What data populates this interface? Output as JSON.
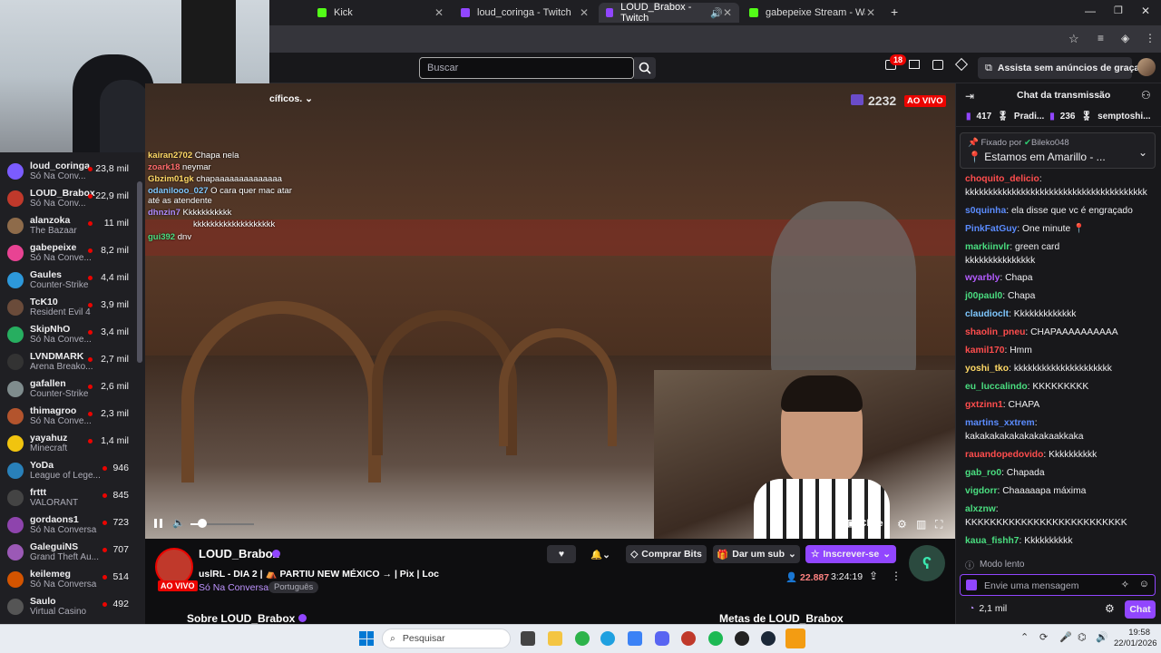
{
  "browser": {
    "tabs": [
      {
        "title": "Kick",
        "color": "#53fc18"
      },
      {
        "title": "loud_coringa - Twitch",
        "color": "#9146ff"
      },
      {
        "title": "LOUD_Brabox - Twitch",
        "color": "#9146ff"
      },
      {
        "title": "gabepeixe Stream - Watch Live",
        "color": "#53fc18"
      }
    ],
    "new_tab": "+"
  },
  "topnav": {
    "search_placeholder": "Buscar",
    "notif_count": "18",
    "ad_free": "Assista sem anúncios de graça"
  },
  "video": {
    "category_text": "cíficos.",
    "viewers": "2232",
    "live_badge": "AO VIVO",
    "clip_label": "Clipe",
    "overlay_chat": [
      {
        "user": "kairan2702",
        "text": "Chapa nela",
        "color": "#ffd966"
      },
      {
        "user": "zoark18",
        "text": "neymar",
        "color": "#ff6b6b"
      },
      {
        "user": "Gbzim01gk",
        "text": "chapaaaaaaaaaaaaaa",
        "color": "#ffd966"
      },
      {
        "user": "odanilooo_027",
        "text": "O cara quer mac atar",
        "color": "#7fc8ff"
      },
      {
        "user": "",
        "text": "até as atendente",
        "color": "#ffffff"
      },
      {
        "user": "dhnzin7",
        "text": "Kkkkkkkkkkk",
        "color": "#b08cff"
      },
      {
        "user": "",
        "text": "kkkkkkkkkkkkkkkkkkk",
        "color": "#ffffff"
      },
      {
        "user": "gui392",
        "text": "dnv",
        "color": "#4ade80"
      }
    ]
  },
  "sidebar": {
    "channels": [
      {
        "name": "loud_coringa",
        "game": "Só Na Conv...",
        "viewers": "23,8 mil",
        "color": "#7b5cff"
      },
      {
        "name": "LOUD_Brabox",
        "game": "Só Na Conv...",
        "viewers": "22,9 mil",
        "color": "#c0392b"
      },
      {
        "name": "alanzoka",
        "game": "The Bazaar",
        "viewers": "11 mil",
        "color": "#8e6b4a"
      },
      {
        "name": "gabepeixe",
        "game": "Só Na Conve...",
        "viewers": "8,2 mil",
        "color": "#e84393"
      },
      {
        "name": "Gaules",
        "game": "Counter-Strike",
        "viewers": "4,4 mil",
        "color": "#2d98da"
      },
      {
        "name": "TcK10",
        "game": "Resident Evil 4",
        "viewers": "3,9 mil",
        "color": "#6a4b3a"
      },
      {
        "name": "SkipNhO",
        "game": "Só Na Conve...",
        "viewers": "3,4 mil",
        "color": "#27ae60"
      },
      {
        "name": "LVNDMARK",
        "game": "Arena Breako...",
        "viewers": "2,7 mil",
        "color": "#333333"
      },
      {
        "name": "gafallen",
        "game": "Counter-Strike",
        "viewers": "2,6 mil",
        "color": "#7f8c8d"
      },
      {
        "name": "thimagroo",
        "game": "Só Na Conve...",
        "viewers": "2,3 mil",
        "color": "#b3542d"
      },
      {
        "name": "yayahuz",
        "game": "Minecraft",
        "viewers": "1,4 mil",
        "color": "#f1c40f"
      },
      {
        "name": "YoDa",
        "game": "League of Lege...",
        "viewers": "946",
        "color": "#2980b9"
      },
      {
        "name": "frttt",
        "game": "VALORANT",
        "viewers": "845",
        "color": "#444444"
      },
      {
        "name": "gordaons1",
        "game": "Só Na Conversa",
        "viewers": "723",
        "color": "#8e44ad"
      },
      {
        "name": "GaleguiNS",
        "game": "Grand Theft Au...",
        "viewers": "707",
        "color": "#9b59b6"
      },
      {
        "name": "keilemeg",
        "game": "Só Na Conversa",
        "viewers": "514",
        "color": "#d35400"
      },
      {
        "name": "Saulo",
        "game": "Virtual Casino",
        "viewers": "492",
        "color": "#555555"
      }
    ]
  },
  "stream": {
    "channel": "LOUD_Brabox",
    "title_part1": "uslRL - DIA 2 |",
    "title_part2": "PARTIU NEW MÉXICO →",
    "title_part3": "| Pix | Loc",
    "live": "AO VIVO",
    "category": "Só Na Conversa",
    "tag": "Português",
    "viewers": "22.887",
    "uptime": "3:24:19",
    "comprar_bits": "Comprar Bits",
    "dar_sub": "Dar um sub",
    "inscrever": "Inscrever-se",
    "about": "Sobre LOUD_Brabox",
    "metas": "Metas de LOUD_Brabox"
  },
  "chat": {
    "header": "Chat da transmissão",
    "leaderboard": [
      {
        "value": "417"
      },
      {
        "value": "Pradi..."
      },
      {
        "value": "236"
      },
      {
        "value": "semptoshi..."
      }
    ],
    "pinned_by": "Fixado por",
    "pinned_user": "Bileko048",
    "pinned_text": "Estamos em Amarillo - ...",
    "messages": [
      {
        "user": "choquito_delicio",
        "text": "",
        "color": "#ff4d4d"
      },
      {
        "user": "",
        "text": "kkkkkkkkkkkkkkkkkkkkkkkkkkkkkkkkkkkkkkk",
        "color": "#ffffff"
      },
      {
        "user": "s0quinha",
        "text": "ela disse que vc é engraçado",
        "color": "#5b8cff"
      },
      {
        "user": "PinkFatGuy",
        "text": "One minute 📍",
        "color": "#5b8cff"
      },
      {
        "user": "markiinvlr",
        "text": "green card",
        "color": "#4ade80"
      },
      {
        "user": "",
        "text": "kkkkkkkkkkkkkkk",
        "color": "#ffffff"
      },
      {
        "user": "wyarbly",
        "text": "Chapa",
        "color": "#b45cff"
      },
      {
        "user": "j00paul0",
        "text": "Chapa",
        "color": "#4ade80"
      },
      {
        "user": "claudioclt",
        "text": "Kkkkkkkkkkkkk",
        "color": "#7fc8ff"
      },
      {
        "user": "shaolin_pneu",
        "text": "CHAPAAAAAAAAAA",
        "color": "#ff4d4d"
      },
      {
        "user": "kamil170",
        "text": "Hmm",
        "color": "#ff4d4d"
      },
      {
        "user": "yoshi_tko",
        "text": "kkkkkkkkkkkkkkkkkkkkk",
        "color": "#ffd966"
      },
      {
        "user": "eu_luccalindo",
        "text": "KKKKKKKKK",
        "color": "#4ade80"
      },
      {
        "user": "gxtzinn1",
        "text": "CHAPA",
        "color": "#ff4d4d"
      },
      {
        "user": "martins_xxtrem",
        "text": "",
        "color": "#5b8cff"
      },
      {
        "user": "",
        "text": "kakakakakakakakakaakkaka",
        "color": "#ffffff"
      },
      {
        "user": "rauandopedovido",
        "text": "Kkkkkkkkkk",
        "color": "#ff4d4d"
      },
      {
        "user": "gab_ro0",
        "text": "Chapada",
        "color": "#4ade80"
      },
      {
        "user": "vigdorr",
        "text": "Chaaaaapa máxima",
        "color": "#4ade80"
      },
      {
        "user": "alxznw",
        "text": "",
        "color": "#4ade80"
      },
      {
        "user": "",
        "text": "KKKKKKKKKKKKKKKKKKKKKKKKKK",
        "color": "#ffffff"
      },
      {
        "user": "kaua_fishh7",
        "text": "Kkkkkkkkkk",
        "color": "#4ade80"
      }
    ],
    "slow_mode": "Modo lento",
    "input_placeholder": "Envie uma mensagem",
    "points": "2,1 mil",
    "chat_button": "Chat"
  },
  "taskbar": {
    "search_placeholder": "Pesquisar",
    "time": "19:58",
    "date": "22/01/2026"
  }
}
